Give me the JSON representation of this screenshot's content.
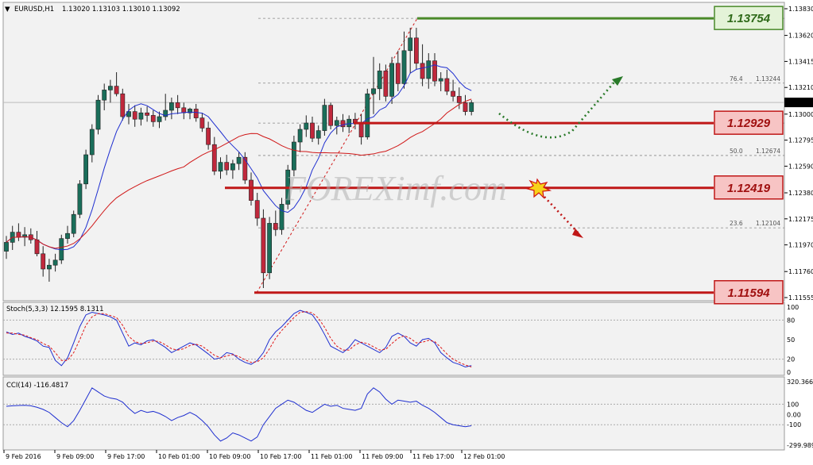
{
  "header": {
    "symbol": "EURUSD,H1",
    "ohlc": "1.13020 1.13103 1.13010 1.13092"
  },
  "watermark": "FOREXimf.com",
  "colors": {
    "background": "#f2f2f2",
    "bull_candle": "#1a6e5a",
    "bear_candle": "#c0283c",
    "ma_fast": "#1f2fd0",
    "ma_slow": "#d01818",
    "green_level": "#4a8a2a",
    "red_level": "#c01818",
    "stoch_main": "#1f2fd0",
    "stoch_signal": "#e01818",
    "cci": "#1f2fd0"
  },
  "chart_data": [
    {
      "type": "candlestick",
      "title": "EURUSD,H1",
      "yaxis_ticks": [
        "1.13830",
        "1.13620",
        "1.13415",
        "1.13210",
        "1.13000",
        "1.12795",
        "1.12590",
        "1.12380",
        "1.12175",
        "1.11970",
        "1.11760",
        "1.11555"
      ],
      "current_price": "1.13092",
      "ylim": [
        1.1153,
        1.1388
      ],
      "xaxis_ticks": [
        "9 Feb 2016",
        "9 Feb 09:00",
        "9 Feb 17:00",
        "10 Feb 01:00",
        "10 Feb 09:00",
        "10 Feb 17:00",
        "11 Feb 01:00",
        "11 Feb 09:00",
        "11 Feb 17:00",
        "12 Feb 01:00"
      ],
      "candles": [
        [
          1.1192,
          1.1204,
          1.1186,
          1.1199
        ],
        [
          1.1199,
          1.1212,
          1.1193,
          1.1207
        ],
        [
          1.1207,
          1.1214,
          1.12,
          1.1203
        ],
        [
          1.1203,
          1.1211,
          1.1196,
          1.1205
        ],
        [
          1.1205,
          1.121,
          1.1198,
          1.1201
        ],
        [
          1.1201,
          1.1208,
          1.1188,
          1.119
        ],
        [
          1.119,
          1.1196,
          1.1172,
          1.1178
        ],
        [
          1.1178,
          1.1186,
          1.1168,
          1.1181
        ],
        [
          1.1181,
          1.119,
          1.1176,
          1.1185
        ],
        [
          1.1185,
          1.1205,
          1.1182,
          1.1202
        ],
        [
          1.1202,
          1.1212,
          1.1198,
          1.1206
        ],
        [
          1.1206,
          1.1224,
          1.1203,
          1.1221
        ],
        [
          1.1221,
          1.1248,
          1.1218,
          1.1245
        ],
        [
          1.1245,
          1.1272,
          1.1241,
          1.1268
        ],
        [
          1.1268,
          1.1292,
          1.1262,
          1.1288
        ],
        [
          1.1288,
          1.1315,
          1.1284,
          1.1311
        ],
        [
          1.1311,
          1.1324,
          1.1303,
          1.1319
        ],
        [
          1.1319,
          1.1327,
          1.1309,
          1.1322
        ],
        [
          1.1322,
          1.1333,
          1.1314,
          1.1316
        ],
        [
          1.1316,
          1.132,
          1.1295,
          1.1298
        ],
        [
          1.1298,
          1.1308,
          1.1292,
          1.1302
        ],
        [
          1.1302,
          1.1307,
          1.129,
          1.1296
        ],
        [
          1.1296,
          1.1305,
          1.1291,
          1.1301
        ],
        [
          1.1301,
          1.1306,
          1.1294,
          1.1299
        ],
        [
          1.1299,
          1.1303,
          1.129,
          1.1294
        ],
        [
          1.1294,
          1.1302,
          1.1289,
          1.1298
        ],
        [
          1.1298,
          1.1316,
          1.1295,
          1.1303
        ],
        [
          1.1303,
          1.1313,
          1.1296,
          1.1309
        ],
        [
          1.1309,
          1.1315,
          1.13,
          1.1305
        ],
        [
          1.1305,
          1.1309,
          1.1296,
          1.1301
        ],
        [
          1.1301,
          1.1305,
          1.1296,
          1.1304
        ],
        [
          1.1304,
          1.1308,
          1.1294,
          1.1297
        ],
        [
          1.1297,
          1.1301,
          1.1286,
          1.1289
        ],
        [
          1.1289,
          1.1294,
          1.1272,
          1.1276
        ],
        [
          1.1276,
          1.1282,
          1.1252,
          1.1255
        ],
        [
          1.1255,
          1.1266,
          1.1249,
          1.1262
        ],
        [
          1.1262,
          1.1268,
          1.1252,
          1.1256
        ],
        [
          1.1256,
          1.1264,
          1.1249,
          1.1261
        ],
        [
          1.1261,
          1.127,
          1.1256,
          1.1266
        ],
        [
          1.1266,
          1.127,
          1.1245,
          1.1248
        ],
        [
          1.1248,
          1.1254,
          1.1228,
          1.1232
        ],
        [
          1.1232,
          1.1238,
          1.1212,
          1.1218
        ],
        [
          1.1218,
          1.1225,
          1.1163,
          1.1175
        ],
        [
          1.1175,
          1.1219,
          1.117,
          1.1214
        ],
        [
          1.1214,
          1.1224,
          1.1204,
          1.1209
        ],
        [
          1.1209,
          1.1234,
          1.1205,
          1.1229
        ],
        [
          1.1229,
          1.126,
          1.1225,
          1.1256
        ],
        [
          1.1256,
          1.1283,
          1.1251,
          1.1278
        ],
        [
          1.1278,
          1.1292,
          1.127,
          1.1288
        ],
        [
          1.1288,
          1.1299,
          1.1282,
          1.1293
        ],
        [
          1.1293,
          1.1298,
          1.1278,
          1.1281
        ],
        [
          1.1281,
          1.1291,
          1.1276,
          1.1287
        ],
        [
          1.1287,
          1.1312,
          1.1283,
          1.1307
        ],
        [
          1.1307,
          1.1309,
          1.1288,
          1.1291
        ],
        [
          1.1291,
          1.1298,
          1.1284,
          1.1295
        ],
        [
          1.1295,
          1.13,
          1.1286,
          1.129
        ],
        [
          1.129,
          1.1299,
          1.1285,
          1.1296
        ],
        [
          1.1296,
          1.1301,
          1.1288,
          1.1293
        ],
        [
          1.1293,
          1.13,
          1.1276,
          1.1282
        ],
        [
          1.1282,
          1.132,
          1.128,
          1.1316
        ],
        [
          1.1316,
          1.1345,
          1.13,
          1.132
        ],
        [
          1.132,
          1.134,
          1.1311,
          1.1334
        ],
        [
          1.1334,
          1.1339,
          1.131,
          1.1314
        ],
        [
          1.1314,
          1.1345,
          1.1308,
          1.134
        ],
        [
          1.134,
          1.135,
          1.1318,
          1.1324
        ],
        [
          1.1324,
          1.1365,
          1.132,
          1.135
        ],
        [
          1.135,
          1.1368,
          1.1332,
          1.136
        ],
        [
          1.136,
          1.1368,
          1.1335,
          1.134
        ],
        [
          1.134,
          1.1355,
          1.1322,
          1.1328
        ],
        [
          1.1328,
          1.1348,
          1.132,
          1.1342
        ],
        [
          1.1342,
          1.1348,
          1.1322,
          1.1326
        ],
        [
          1.1326,
          1.1333,
          1.1318,
          1.1328
        ],
        [
          1.1328,
          1.1335,
          1.1315,
          1.1318
        ],
        [
          1.1318,
          1.1327,
          1.131,
          1.1314
        ],
        [
          1.1314,
          1.1321,
          1.1304,
          1.1309
        ],
        [
          1.1309,
          1.1315,
          1.1299,
          1.1302
        ],
        [
          1.1302,
          1.1311,
          1.1299,
          1.1309
        ]
      ],
      "ma_fast_name": "",
      "ma_slow_name": ""
    },
    {
      "type": "line",
      "title": "Stoch(5,3,3) 12.1595 8.1311",
      "yaxis_ticks": [
        "100",
        "80",
        "50",
        "20",
        "0"
      ],
      "ylim": [
        0,
        100
      ],
      "main": [
        62,
        58,
        60,
        55,
        52,
        48,
        40,
        38,
        18,
        10,
        22,
        45,
        70,
        88,
        92,
        90,
        88,
        85,
        80,
        60,
        40,
        45,
        42,
        48,
        50,
        44,
        38,
        30,
        35,
        40,
        45,
        42,
        35,
        28,
        20,
        22,
        30,
        28,
        20,
        15,
        12,
        18,
        30,
        50,
        62,
        70,
        80,
        90,
        95,
        92,
        88,
        75,
        58,
        40,
        35,
        30,
        38,
        50,
        45,
        40,
        35,
        30,
        38,
        55,
        60,
        55,
        45,
        40,
        50,
        52,
        45,
        30,
        22,
        15,
        12,
        8,
        10
      ],
      "signal": [
        60,
        60,
        58,
        57,
        53,
        50,
        44,
        40,
        30,
        18,
        18,
        30,
        50,
        72,
        85,
        90,
        90,
        87,
        84,
        72,
        55,
        47,
        44,
        45,
        48,
        47,
        42,
        36,
        34,
        36,
        41,
        43,
        40,
        33,
        26,
        22,
        25,
        27,
        24,
        19,
        15,
        16,
        22,
        36,
        52,
        64,
        74,
        84,
        92,
        93,
        91,
        83,
        69,
        52,
        40,
        34,
        34,
        42,
        46,
        44,
        39,
        34,
        35,
        44,
        52,
        56,
        52,
        45,
        46,
        49,
        47,
        38,
        28,
        20,
        15,
        11,
        8
      ]
    },
    {
      "type": "line",
      "title": "CCI(14) -116.4817",
      "yaxis_ticks": [
        "320.366",
        "100",
        "0.00",
        "-100",
        "-299.989"
      ],
      "ylim": [
        -299.989,
        320.366
      ],
      "values": [
        80,
        85,
        88,
        90,
        85,
        70,
        50,
        20,
        -30,
        -80,
        -120,
        -60,
        40,
        150,
        260,
        220,
        180,
        160,
        150,
        120,
        60,
        10,
        40,
        20,
        30,
        10,
        -20,
        -60,
        -30,
        -10,
        20,
        -10,
        -60,
        -120,
        -200,
        -260,
        -230,
        -180,
        -200,
        -230,
        -260,
        -220,
        -100,
        -20,
        60,
        100,
        140,
        120,
        80,
        40,
        20,
        60,
        100,
        80,
        90,
        60,
        50,
        40,
        60,
        200,
        260,
        220,
        150,
        100,
        140,
        130,
        120,
        130,
        90,
        60,
        20,
        -30,
        -80,
        -100,
        -110,
        -120,
        -110
      ]
    }
  ],
  "levels": [
    {
      "label": "1.13754",
      "price": 1.13754,
      "color": "green"
    },
    {
      "label": "1.12929",
      "price": 1.12929,
      "color": "red"
    },
    {
      "label": "1.12419",
      "price": 1.12419,
      "color": "red"
    },
    {
      "label": "1.11594",
      "price": 1.11594,
      "color": "red"
    }
  ],
  "fib_labels": [
    {
      "ratio": "76.4",
      "price": "1.13244"
    },
    {
      "ratio": "50.0",
      "price": "1.12674"
    },
    {
      "ratio": "23.6",
      "price": "1.12104"
    }
  ]
}
